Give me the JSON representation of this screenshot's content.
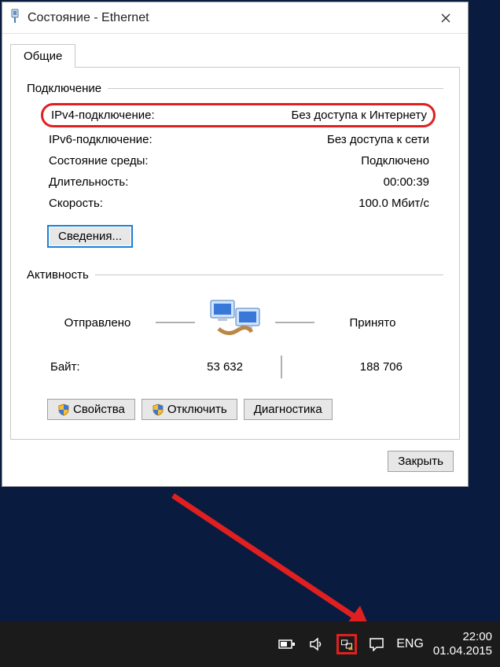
{
  "window": {
    "title": "Состояние - Ethernet"
  },
  "tabs": {
    "general": "Общие"
  },
  "connection": {
    "group_label": "Подключение",
    "ipv4_label": "IPv4-подключение:",
    "ipv4_value": "Без доступа к Интернету",
    "ipv6_label": "IPv6-подключение:",
    "ipv6_value": "Без доступа к сети",
    "media_label": "Состояние среды:",
    "media_value": "Подключено",
    "duration_label": "Длительность:",
    "duration_value": "00:00:39",
    "speed_label": "Скорость:",
    "speed_value": "100.0 Мбит/с",
    "details_button": "Сведения..."
  },
  "activity": {
    "group_label": "Активность",
    "sent_label": "Отправлено",
    "received_label": "Принято",
    "bytes_label": "Байт:",
    "sent_bytes": "53 632",
    "received_bytes": "188 706"
  },
  "buttons": {
    "properties": "Свойства",
    "disable": "Отключить",
    "diagnose": "Диагностика",
    "close": "Закрыть"
  },
  "taskbar": {
    "language": "ENG",
    "time": "22:00",
    "date": "01.04.2015"
  }
}
